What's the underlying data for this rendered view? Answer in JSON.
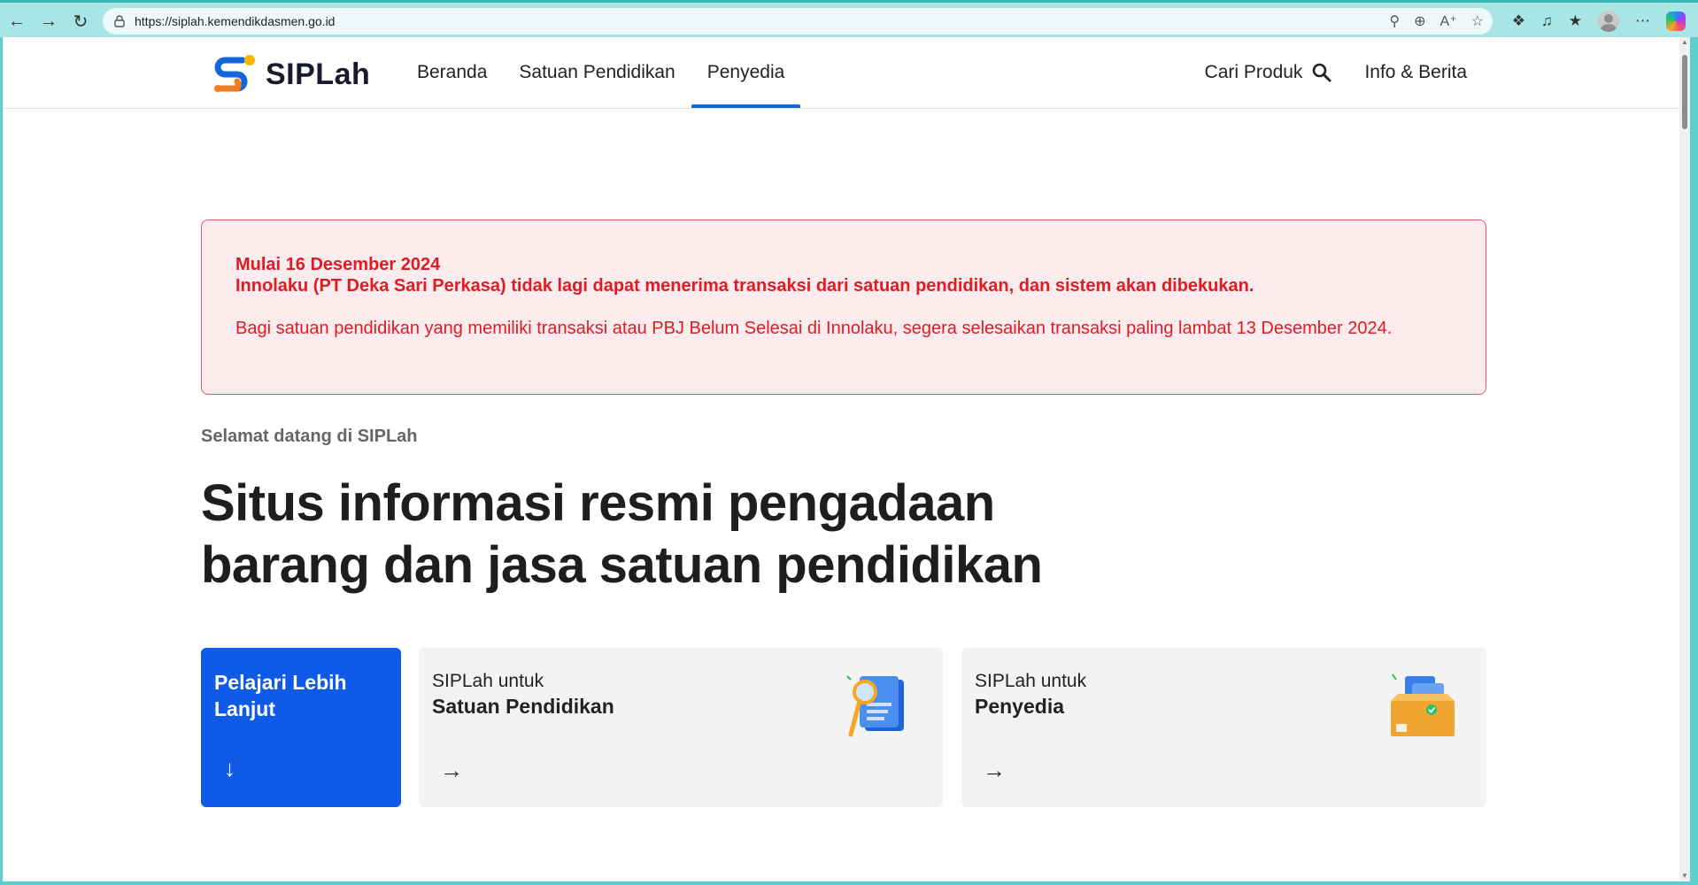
{
  "browser": {
    "url": "https://siplah.kemendikdasmen.go.id"
  },
  "site": {
    "logo_text": "SIPLah",
    "nav": [
      {
        "label": "Beranda"
      },
      {
        "label": "Satuan Pendidikan"
      },
      {
        "label": "Penyedia"
      }
    ],
    "active_nav": "Penyedia",
    "search_label": "Cari Produk",
    "info_label": "Info & Berita"
  },
  "alert": {
    "line1": "Mulai 16 Desember 2024",
    "line2": "Innolaku (PT Deka Sari Perkasa) tidak lagi dapat menerima transaksi dari satuan pendidikan, dan sistem akan dibekukan.",
    "line3": "Bagi satuan pendidikan yang memiliki transaksi atau PBJ Belum Selesai di Innolaku, segera selesaikan transaksi paling lambat 13 Desember 2024."
  },
  "hero": {
    "welcome": "Selamat datang di SIPLah",
    "headline": "Situs informasi resmi pengadaan barang dan jasa satuan pendidikan"
  },
  "cards": [
    {
      "title": "Pelajari Lebih Lanjut",
      "icon": "arrow-down-icon"
    },
    {
      "small": "SIPLah untuk",
      "big": "Satuan Pendidikan",
      "icon": "arrow-right-icon"
    },
    {
      "small": "SIPLah untuk",
      "big": "Penyedia",
      "icon": "arrow-right-icon"
    }
  ],
  "colors": {
    "accent": "#0f5be8",
    "alert_text": "#e01b24",
    "alert_bg": "#fdecee"
  }
}
